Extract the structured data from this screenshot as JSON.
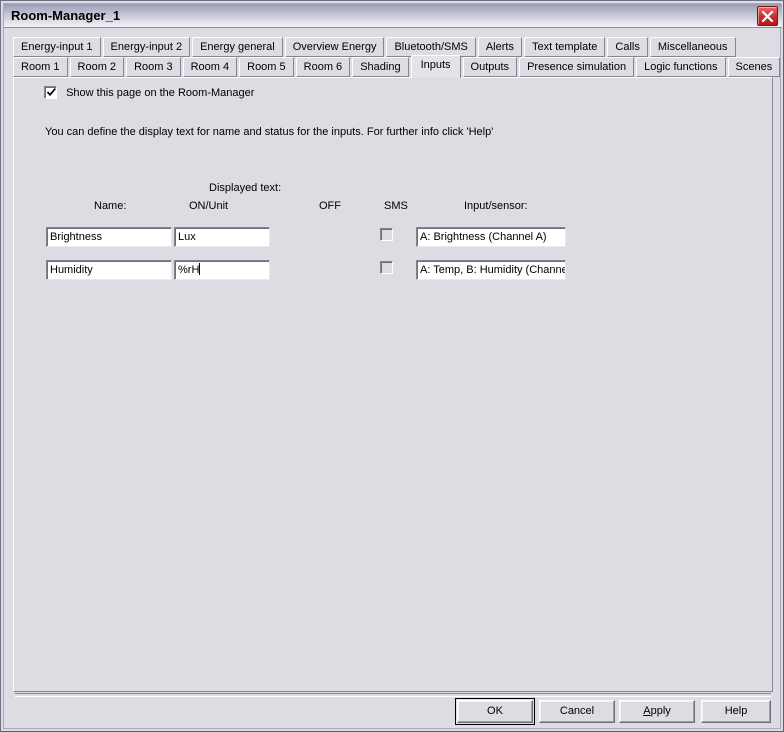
{
  "window": {
    "title": "Room-Manager_1",
    "close_icon": "close-x-icon"
  },
  "tabs": {
    "row_top": [
      {
        "label": "Energy-input 1",
        "selected": false
      },
      {
        "label": "Energy-input 2",
        "selected": false
      },
      {
        "label": "Energy general",
        "selected": false
      },
      {
        "label": "Overview Energy",
        "selected": false
      },
      {
        "label": "Bluetooth/SMS",
        "selected": false
      },
      {
        "label": "Alerts",
        "selected": false
      },
      {
        "label": "Text template",
        "selected": false
      },
      {
        "label": "Calls",
        "selected": false
      },
      {
        "label": "Miscellaneous",
        "selected": false
      }
    ],
    "row_bottom": [
      {
        "label": "Room 1",
        "selected": false
      },
      {
        "label": "Room 2",
        "selected": false
      },
      {
        "label": "Room 3",
        "selected": false
      },
      {
        "label": "Room 4",
        "selected": false
      },
      {
        "label": "Room 5",
        "selected": false
      },
      {
        "label": "Room 6",
        "selected": false
      },
      {
        "label": "Shading",
        "selected": false
      },
      {
        "label": "Inputs",
        "selected": true
      },
      {
        "label": "Outputs",
        "selected": false
      },
      {
        "label": "Presence simulation",
        "selected": false
      },
      {
        "label": "Logic functions",
        "selected": false
      },
      {
        "label": "Scenes",
        "selected": false
      }
    ]
  },
  "page": {
    "show_page_checkbox": {
      "label": "Show this page on the Room-Manager",
      "checked": true
    },
    "description": "You can define the display text for name and status for the inputs. For further info click 'Help'",
    "group_header": "Displayed text:",
    "columns": {
      "name": "Name:",
      "on_unit": "ON/Unit",
      "off": "OFF",
      "sms": "SMS",
      "sensor": "Input/sensor:"
    },
    "rows": [
      {
        "name": "Brightness",
        "on_unit": "Lux",
        "off": "",
        "sms_checked": false,
        "sensor": "A: Brightness  (Channel A)",
        "focused": false
      },
      {
        "name": "Humidity",
        "on_unit": "%rH",
        "off": "",
        "sms_checked": false,
        "sensor": "A: Temp, B: Humidity  (Channel",
        "focused": true
      }
    ]
  },
  "buttons": {
    "ok": "OK",
    "cancel": "Cancel",
    "apply_accel": "A",
    "apply_rest": "pply",
    "help": "Help"
  },
  "colors": {
    "dialog_bg": "#dcdce2",
    "tab_panel_bg": "#dcdce2",
    "selected_tab_bg": "#e3e3e9",
    "close_button_red": "#cc2a2a",
    "border_shadow": "#85858f",
    "field_bg": "#ffffff",
    "text": "#000000"
  }
}
